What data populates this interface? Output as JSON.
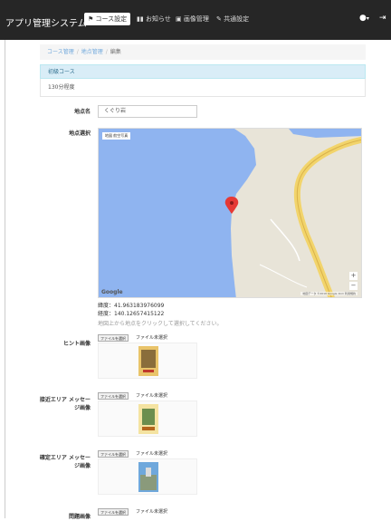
{
  "navbar": {
    "brand": "アプリ管理システム",
    "items": [
      {
        "icon": "flag-icon",
        "label": "コース設定",
        "active": true
      },
      {
        "icon": "list-icon",
        "label": "お知らせ"
      },
      {
        "icon": "image-icon",
        "label": "画像管理"
      },
      {
        "icon": "wrench-icon",
        "label": "共通設定"
      }
    ],
    "user_icon": "user-icon",
    "logout_icon": "logout-icon"
  },
  "breadcrumb": {
    "items": [
      "コース管理",
      "地点管理",
      "編集"
    ]
  },
  "panel": {
    "heading": "初級コース",
    "body": "130分程度"
  },
  "form": {
    "spot_name_label": "地点名",
    "spot_name_value": "くぐり岩",
    "location_label": "地点選択",
    "map": {
      "type_buttons": [
        "地図",
        "航空写真"
      ],
      "google_logo": "Google",
      "attribution": "地図データ ©2016 Google   1km   利用規約",
      "zoom_in": "+",
      "zoom_out": "−"
    },
    "latitude": "緯度：41.963183976099",
    "longitude": "経度：140.12657415122",
    "help_text": "地図上から地点をクリックして選択してください。",
    "uploads": [
      {
        "label": "ヒント画像",
        "button": "ファイルを選択",
        "status": "ファイル未選択"
      },
      {
        "label": "接近エリア メッセージ画像",
        "button": "ファイルを選択",
        "status": "ファイル未選択"
      },
      {
        "label": "確定エリア メッセージ画像",
        "button": "ファイルを選択",
        "status": "ファイル未選択"
      },
      {
        "label": "問題画像",
        "button": "ファイルを選択",
        "status": "ファイル未選択"
      }
    ]
  },
  "colors": {
    "navbar": "#262626",
    "link": "#6fa8dc",
    "panel_head_bg": "#d9edf7",
    "map_sea": "#8fb4f0",
    "map_land": "#e8e4d8",
    "road": "#f2d46b",
    "marker": "#e53935"
  }
}
